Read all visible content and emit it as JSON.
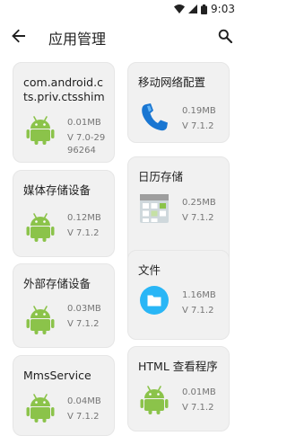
{
  "status_bar": {
    "time": "9:03"
  },
  "app_bar": {
    "title": "应用管理"
  },
  "apps": [
    {
      "name": "com.android.cts.priv.ctsshim",
      "size": "0.01MB",
      "version": "V 7.0-29",
      "version_cont": "96264",
      "icon": "android-icon"
    },
    {
      "name": "移动网络配置",
      "size": "0.19MB",
      "version": "V 7.1.2",
      "icon": "phone-icon"
    },
    {
      "name": "媒体存储设备",
      "size": "0.12MB",
      "version": "V 7.1.2",
      "icon": "android-icon"
    },
    {
      "name": "日历存储",
      "size": "0.25MB",
      "version": "V 7.1.2",
      "icon": "calendar-icon"
    },
    {
      "name": "外部存储设备",
      "size": "0.03MB",
      "version": "V 7.1.2",
      "icon": "android-icon"
    },
    {
      "name": "文件",
      "size": "1.16MB",
      "version": "V 7.1.2",
      "icon": "folder-icon"
    },
    {
      "name": "MmsService",
      "size": "0.04MB",
      "version": "V 7.1.2",
      "icon": "android-icon"
    },
    {
      "name": "HTML 查看程序",
      "size": "0.01MB",
      "version": "V 7.1.2",
      "icon": "android-icon"
    }
  ]
}
